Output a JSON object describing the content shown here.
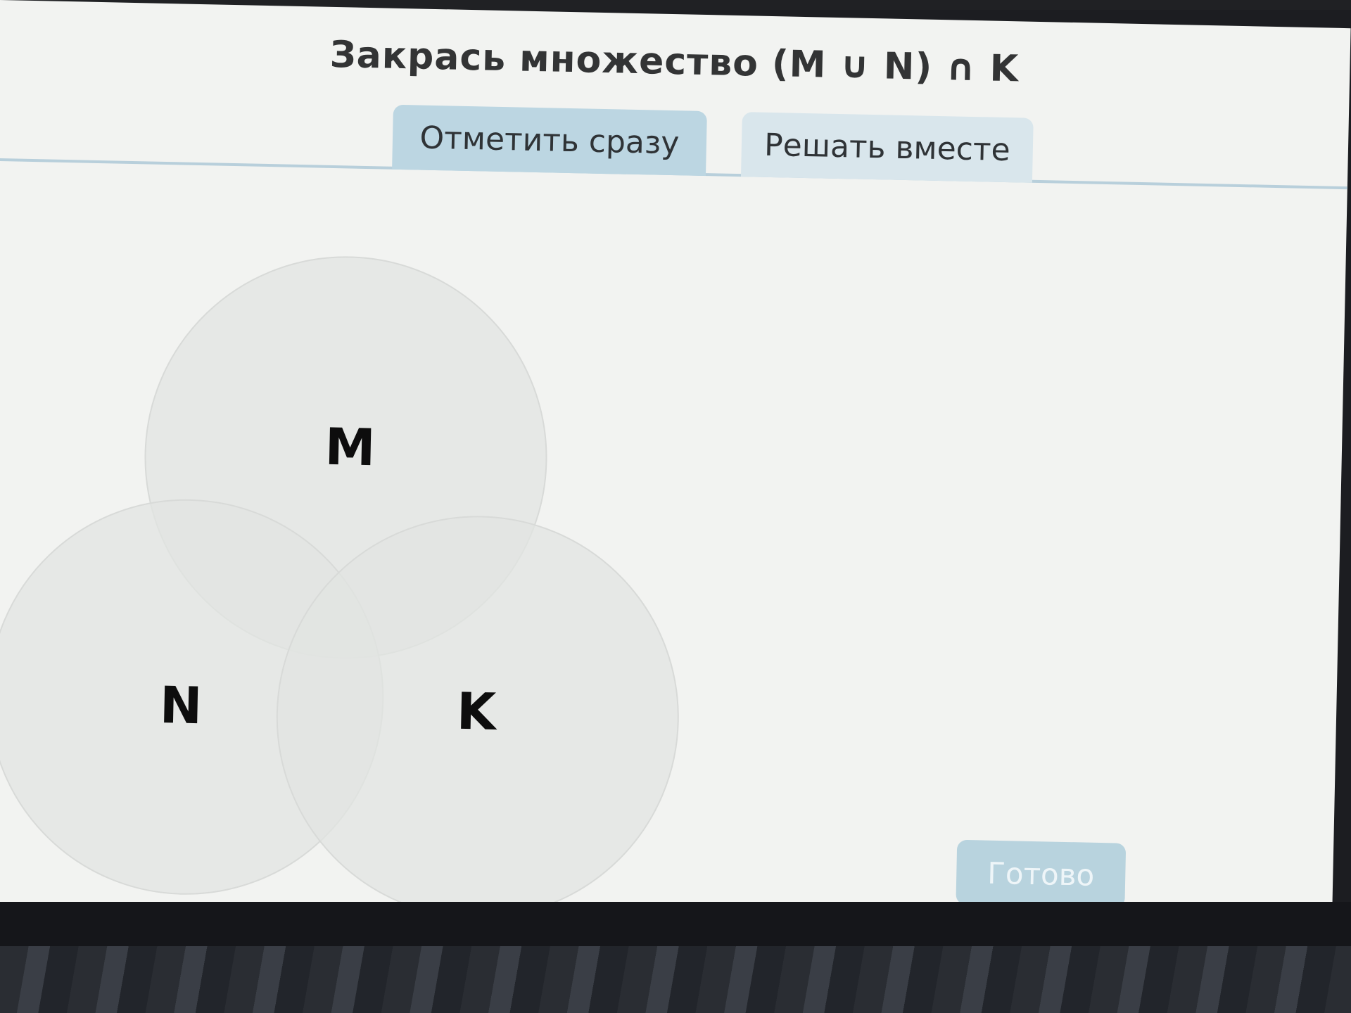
{
  "task": {
    "title": "Закрась множество (M ∪ N) ∩ K"
  },
  "tabs": [
    {
      "label": "Отметить сразу",
      "active": true
    },
    {
      "label": "Решать вместе",
      "active": false
    }
  ],
  "venn": {
    "sets": [
      {
        "label": "M"
      },
      {
        "label": "N"
      },
      {
        "label": "K"
      }
    ]
  },
  "actions": {
    "done_label": "Готово"
  },
  "colors": {
    "tab_active": "#bcd6e2",
    "tab_inactive": "#d9e6ec",
    "done_button": "#b8d3de",
    "circle_fill": "#e4e6e4"
  }
}
